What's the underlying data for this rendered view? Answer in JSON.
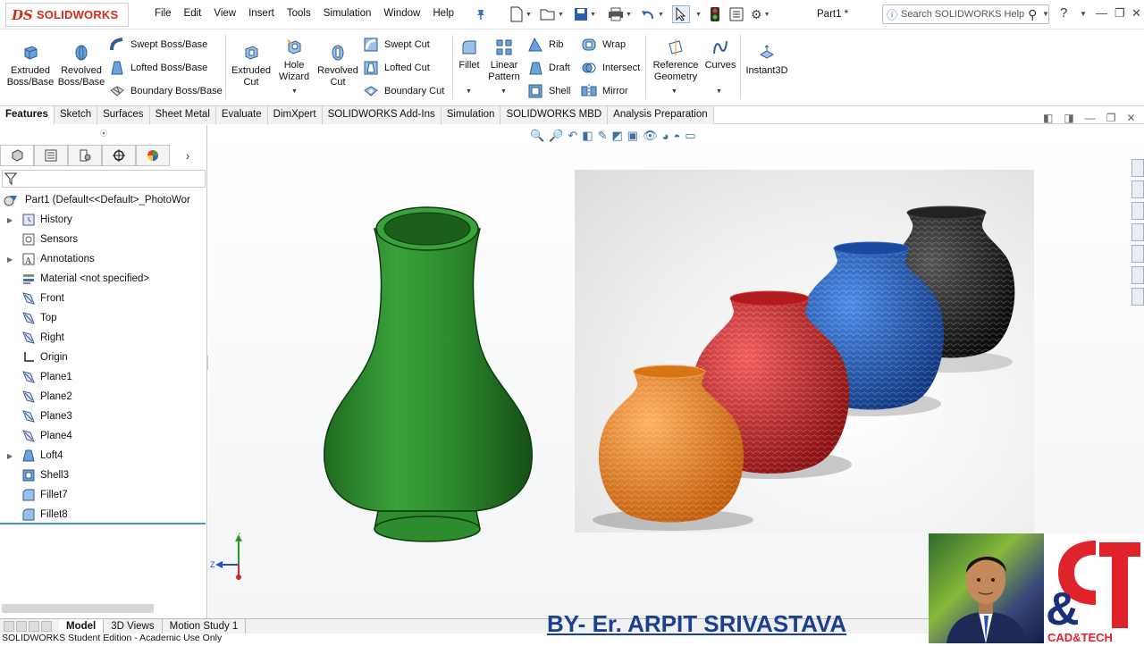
{
  "app": {
    "brand": "SOLIDWORKS",
    "brand_mark": "DS",
    "document_title": "Part1 *",
    "search_placeholder": "Search SOLIDWORKS Help",
    "help": "?"
  },
  "menu": [
    "File",
    "Edit",
    "View",
    "Insert",
    "Tools",
    "Simulation",
    "Window",
    "Help"
  ],
  "ribbon": {
    "extruded_boss": "Extruded Boss/Base",
    "revolved_boss": "Revolved Boss/Base",
    "swept_boss": "Swept Boss/Base",
    "lofted_boss": "Lofted Boss/Base",
    "boundary_boss": "Boundary Boss/Base",
    "extruded_cut": "Extruded Cut",
    "hole_wizard": "Hole Wizard",
    "revolved_cut": "Revolved Cut",
    "swept_cut": "Swept Cut",
    "lofted_cut": "Lofted Cut",
    "boundary_cut": "Boundary Cut",
    "fillet": "Fillet",
    "linear_pattern": "Linear Pattern",
    "rib": "Rib",
    "draft": "Draft",
    "shell": "Shell",
    "wrap": "Wrap",
    "intersect": "Intersect",
    "mirror": "Mirror",
    "reference_geometry": "Reference Geometry",
    "curves": "Curves",
    "instant3d": "Instant3D"
  },
  "tabs": [
    {
      "label": "Features",
      "active": true
    },
    {
      "label": "Sketch"
    },
    {
      "label": "Surfaces"
    },
    {
      "label": "Sheet Metal"
    },
    {
      "label": "Evaluate"
    },
    {
      "label": "DimXpert"
    },
    {
      "label": "SOLIDWORKS Add-Ins"
    },
    {
      "label": "Simulation"
    },
    {
      "label": "SOLIDWORKS MBD"
    },
    {
      "label": "Analysis Preparation"
    }
  ],
  "tree": {
    "root": "Part1  (Default<<Default>_PhotoWor",
    "items": [
      {
        "label": "History",
        "icon": "history-icon",
        "expandable": true
      },
      {
        "label": "Sensors",
        "icon": "sensors-icon"
      },
      {
        "label": "Annotations",
        "icon": "annotations-icon",
        "expandable": true
      },
      {
        "label": "Material <not specified>",
        "icon": "material-icon"
      },
      {
        "label": "Front",
        "icon": "plane-icon"
      },
      {
        "label": "Top",
        "icon": "plane-icon"
      },
      {
        "label": "Right",
        "icon": "plane-icon"
      },
      {
        "label": "Origin",
        "icon": "origin-icon"
      },
      {
        "label": "Plane1",
        "icon": "plane-icon"
      },
      {
        "label": "Plane2",
        "icon": "plane-icon"
      },
      {
        "label": "Plane3",
        "icon": "plane-icon"
      },
      {
        "label": "Plane4",
        "icon": "plane-icon"
      },
      {
        "label": "Loft4",
        "icon": "loft-icon",
        "expandable": true
      },
      {
        "label": "Shell3",
        "icon": "shell-icon"
      },
      {
        "label": "Fillet7",
        "icon": "fillet-icon"
      },
      {
        "label": "Fillet8",
        "icon": "fillet-icon"
      }
    ]
  },
  "bottom_tabs": [
    {
      "label": "Model",
      "active": true
    },
    {
      "label": "3D Views"
    },
    {
      "label": "Motion Study 1"
    }
  ],
  "status": "SOLIDWORKS Student Edition - Academic Use Only",
  "triad": {
    "y": "Y",
    "z": "Z"
  },
  "overlay": {
    "byline": "BY- Er. ARPIT SRIVASTAVA",
    "logo_letters": "C&T",
    "logo_caption": "CAD&TECH"
  },
  "colors": {
    "vase": "#2f8a2f",
    "pot_orange": "#f08a24",
    "pot_red": "#d8262a",
    "pot_blue": "#1e5fc8",
    "pot_black": "#1a1a1a",
    "byline": "#1b3f91",
    "brand": "#d52b1e"
  }
}
